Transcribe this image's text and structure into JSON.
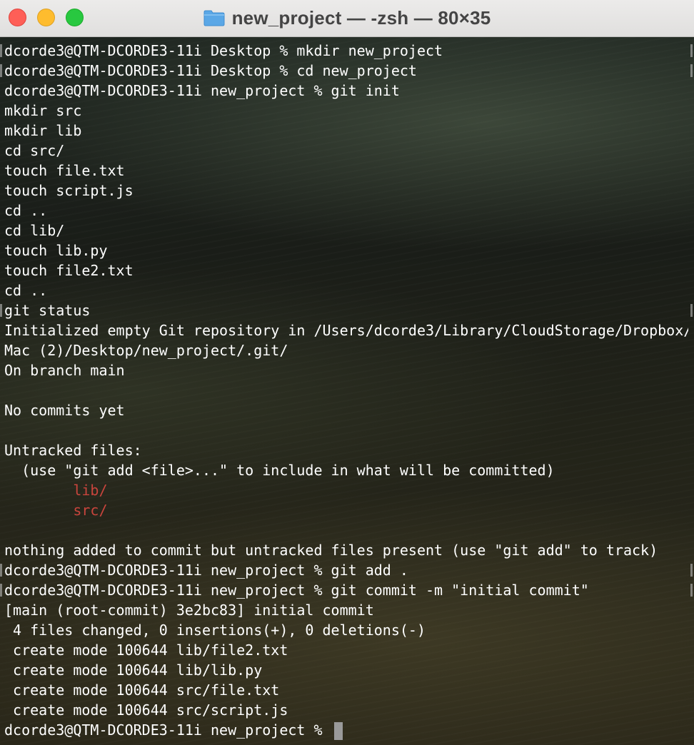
{
  "window": {
    "title": "new_project — -zsh — 80×35"
  },
  "terminal": {
    "lines": [
      "dcorde3@QTM-DCORDE3-11i Desktop % mkdir new_project",
      "dcorde3@QTM-DCORDE3-11i Desktop % cd new_project",
      "dcorde3@QTM-DCORDE3-11i new_project % git init",
      "mkdir src",
      "mkdir lib",
      "cd src/",
      "touch file.txt",
      "touch script.js",
      "cd ..",
      "cd lib/",
      "touch lib.py",
      "touch file2.txt",
      "cd ..",
      "git status",
      "Initialized empty Git repository in /Users/dcorde3/Library/CloudStorage/Dropbox/",
      "Mac (2)/Desktop/new_project/.git/",
      "On branch main",
      "",
      "No commits yet",
      "",
      "Untracked files:",
      "  (use \"git add <file>...\" to include in what will be committed)",
      "        lib/",
      "        src/",
      "",
      "nothing added to commit but untracked files present (use \"git add\" to track)",
      "dcorde3@QTM-DCORDE3-11i new_project % git add .",
      "dcorde3@QTM-DCORDE3-11i new_project % git commit -m \"initial commit\"",
      "[main (root-commit) 3e2bc83] initial commit",
      " 4 files changed, 0 insertions(+), 0 deletions(-)",
      " create mode 100644 lib/file2.txt",
      " create mode 100644 lib/lib.py",
      " create mode 100644 src/file.txt",
      " create mode 100644 src/script.js"
    ],
    "prompt": "dcorde3@QTM-DCORDE3-11i new_project % ",
    "colors": {
      "text": "#ffffff",
      "untracked": "#c9453d"
    }
  }
}
